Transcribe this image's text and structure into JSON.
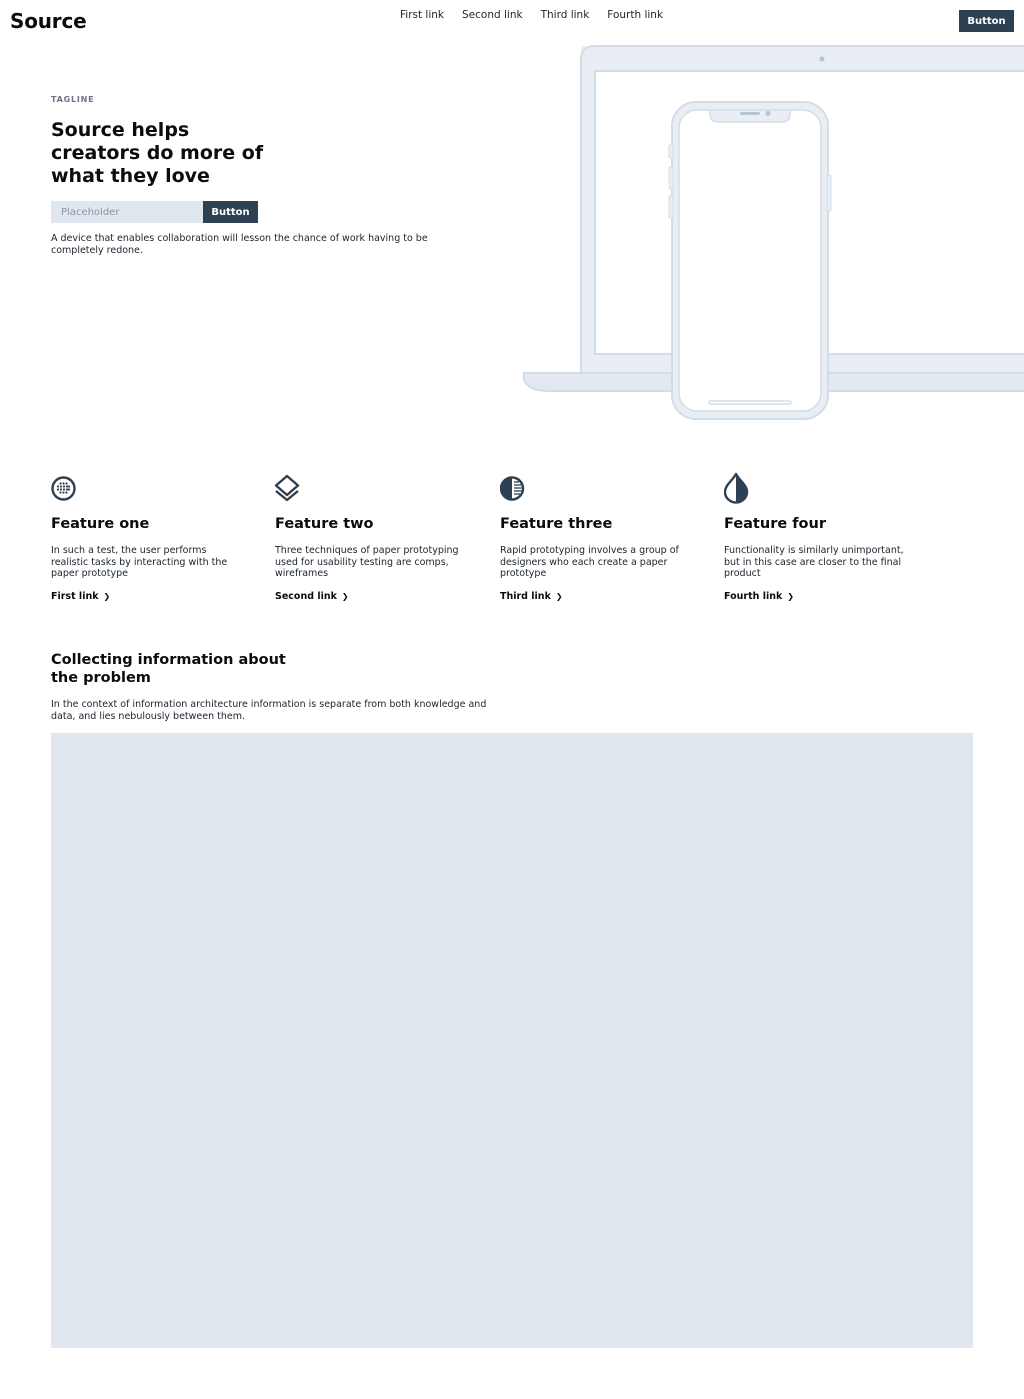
{
  "header": {
    "logo": "Source",
    "nav": [
      "First link",
      "Second link",
      "Third link",
      "Fourth link"
    ],
    "button_label": "Button"
  },
  "hero": {
    "tagline": "TAGLINE",
    "headline": "Source helps creators do more of what they love",
    "input_placeholder": "Placeholder",
    "button_label": "Button",
    "description": "A device that enables collaboration will lesson the chance of work having to be completely redone."
  },
  "features": [
    {
      "icon": "globe-grid-icon",
      "title": "Feature one",
      "text": "In such a test, the user performs realistic tasks by interacting with the paper prototype",
      "link": "First link"
    },
    {
      "icon": "layers-icon",
      "title": "Feature two",
      "text": "Three techniques of paper prototyping used for usability testing are comps, wireframes",
      "link": "Second link"
    },
    {
      "icon": "contrast-icon",
      "title": "Feature three",
      "text": "Rapid prototyping involves a group of designers who each create a paper prototype",
      "link": "Third link"
    },
    {
      "icon": "drop-icon",
      "title": "Feature four",
      "text": "Functionality is similarly unimportant, but in this case are closer to the final product",
      "link": "Fourth link"
    }
  ],
  "info": {
    "title": "Collecting information about the problem",
    "description": "In the context of information architecture information is separate from both knowledge and data, and lies nebulously between them."
  },
  "colors": {
    "primary": "#2d4152",
    "placeholder_fill": "#e0e7ef",
    "device_outline": "#d3dde7"
  },
  "chevron": "❯"
}
